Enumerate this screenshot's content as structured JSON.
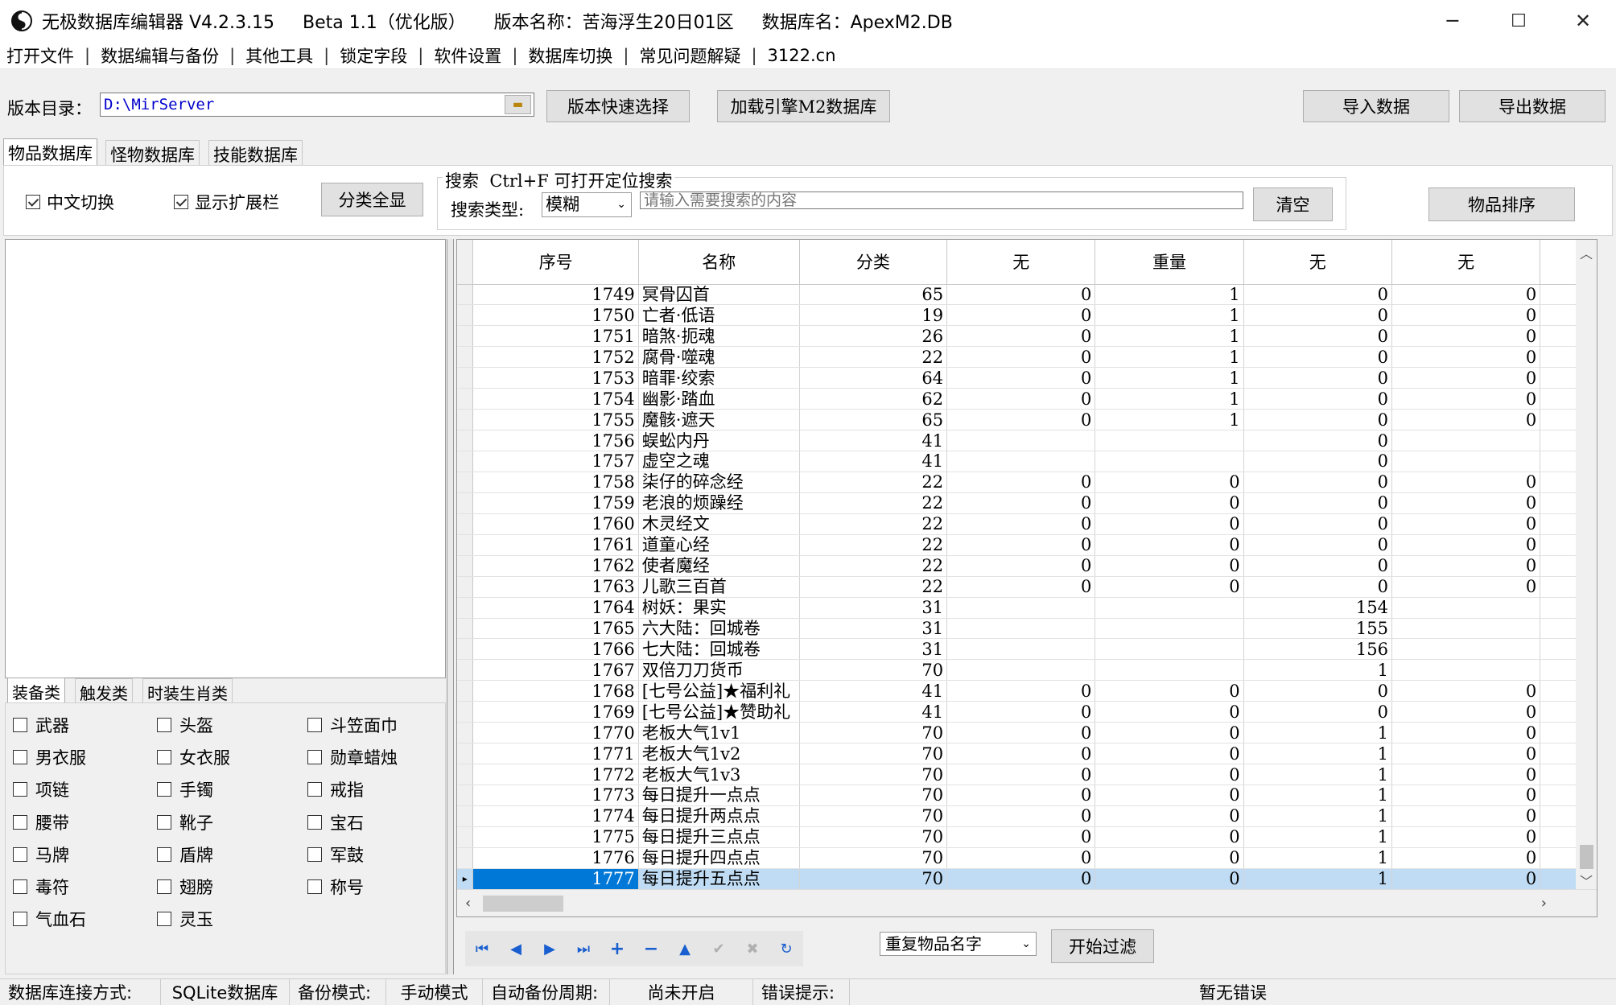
{
  "window": {
    "title": "无极数据库编辑器 V4.2.3.15     Beta 1.1（优化版）     版本名称：苦海浮生20日01区     数据库名：ApexM2.DB",
    "min": "─",
    "max": "☐",
    "close": "✕"
  },
  "menu": [
    "打开文件",
    "数据编辑与备份",
    "其他工具",
    "锁定字段",
    "软件设置",
    "数据库切换",
    "常见问题解疑",
    "3122.cn"
  ],
  "toolbar": {
    "dir_label": "版本目录：",
    "dir_value": "D:\\MirServer",
    "quick_select": "版本快速选择",
    "load_m2": "加载引擎M2数据库",
    "import": "导入数据",
    "export": "导出数据"
  },
  "tabs": [
    "物品数据库",
    "怪物数据库",
    "技能数据库"
  ],
  "options": {
    "chinese": "中文切换",
    "ext_bar": "显示扩展栏",
    "show_all": "分类全显",
    "search_title": "搜索  Ctrl+F 可打开定位搜索",
    "search_type_label": "搜索类型:",
    "search_type_value": "模糊",
    "search_placeholder": "请输入需要搜索的内容",
    "clear": "清空",
    "sort": "物品排序"
  },
  "sub_tabs": [
    "装备类",
    "触发类",
    "时装生肖类"
  ],
  "categories": [
    [
      "武器",
      "头盔",
      "斗笠面巾"
    ],
    [
      "男衣服",
      "女衣服",
      "勋章蜡烛"
    ],
    [
      "项链",
      "手镯",
      "戒指"
    ],
    [
      "腰带",
      "靴子",
      "宝石"
    ],
    [
      "马牌",
      "盾牌",
      "军鼓"
    ],
    [
      "毒符",
      "翅膀",
      "称号"
    ],
    [
      "气血石",
      "灵玉",
      ""
    ]
  ],
  "grid": {
    "columns": [
      "序号",
      "名称",
      "分类",
      "无",
      "重量",
      "无",
      "无"
    ],
    "rows": [
      [
        "1749",
        "冥骨囚首",
        "65",
        "0",
        "1",
        "0",
        "0"
      ],
      [
        "1750",
        "亡者·低语",
        "19",
        "0",
        "1",
        "0",
        "0"
      ],
      [
        "1751",
        "暗煞·扼魂",
        "26",
        "0",
        "1",
        "0",
        "0"
      ],
      [
        "1752",
        "腐骨·噬魂",
        "22",
        "0",
        "1",
        "0",
        "0"
      ],
      [
        "1753",
        "暗罪·绞索",
        "64",
        "0",
        "1",
        "0",
        "0"
      ],
      [
        "1754",
        "幽影·踏血",
        "62",
        "0",
        "1",
        "0",
        "0"
      ],
      [
        "1755",
        "魔骸·遮天",
        "65",
        "0",
        "1",
        "0",
        "0"
      ],
      [
        "1756",
        "蜈蚣内丹",
        "41",
        "",
        "",
        "0",
        ""
      ],
      [
        "1757",
        "虚空之魂",
        "41",
        "",
        "",
        "0",
        ""
      ],
      [
        "1758",
        "柒仔的碎念经",
        "22",
        "0",
        "0",
        "0",
        "0"
      ],
      [
        "1759",
        "老浪的烦躁经",
        "22",
        "0",
        "0",
        "0",
        "0"
      ],
      [
        "1760",
        "木灵经文",
        "22",
        "0",
        "0",
        "0",
        "0"
      ],
      [
        "1761",
        "道童心经",
        "22",
        "0",
        "0",
        "0",
        "0"
      ],
      [
        "1762",
        "使者魔经",
        "22",
        "0",
        "0",
        "0",
        "0"
      ],
      [
        "1763",
        "儿歌三百首",
        "22",
        "0",
        "0",
        "0",
        "0"
      ],
      [
        "1764",
        "树妖：果实",
        "31",
        "",
        "",
        "154",
        ""
      ],
      [
        "1765",
        "六大陆：回城卷",
        "31",
        "",
        "",
        "155",
        ""
      ],
      [
        "1766",
        "七大陆：回城卷",
        "31",
        "",
        "",
        "156",
        ""
      ],
      [
        "1767",
        "双倍刀刀货币",
        "70",
        "",
        "",
        "1",
        ""
      ],
      [
        "1768",
        "[七号公益]★福利礼",
        "41",
        "0",
        "0",
        "0",
        "0"
      ],
      [
        "1769",
        "[七号公益]★赞助礼",
        "41",
        "0",
        "0",
        "0",
        "0"
      ],
      [
        "1770",
        "老板大气1v1",
        "70",
        "0",
        "0",
        "1",
        "0"
      ],
      [
        "1771",
        "老板大气1v2",
        "70",
        "0",
        "0",
        "1",
        "0"
      ],
      [
        "1772",
        "老板大气1v3",
        "70",
        "0",
        "0",
        "1",
        "0"
      ],
      [
        "1773",
        "每日提升一点点",
        "70",
        "0",
        "0",
        "1",
        "0"
      ],
      [
        "1774",
        "每日提升两点点",
        "70",
        "0",
        "0",
        "1",
        "0"
      ],
      [
        "1775",
        "每日提升三点点",
        "70",
        "0",
        "0",
        "1",
        "0"
      ],
      [
        "1776",
        "每日提升四点点",
        "70",
        "0",
        "0",
        "1",
        "0"
      ],
      [
        "1777",
        "每日提升五点点",
        "70",
        "0",
        "0",
        "1",
        "0"
      ]
    ],
    "selected_row": "1777"
  },
  "filter": {
    "select_value": "重复物品名字",
    "start": "开始过滤"
  },
  "status": [
    [
      "数据库连接方式:",
      "SQLite数据库"
    ],
    [
      "备份模式:",
      "手动模式"
    ],
    [
      "自动备份周期:",
      "尚未开启"
    ],
    [
      "错误提示:",
      "暂无错误"
    ]
  ]
}
